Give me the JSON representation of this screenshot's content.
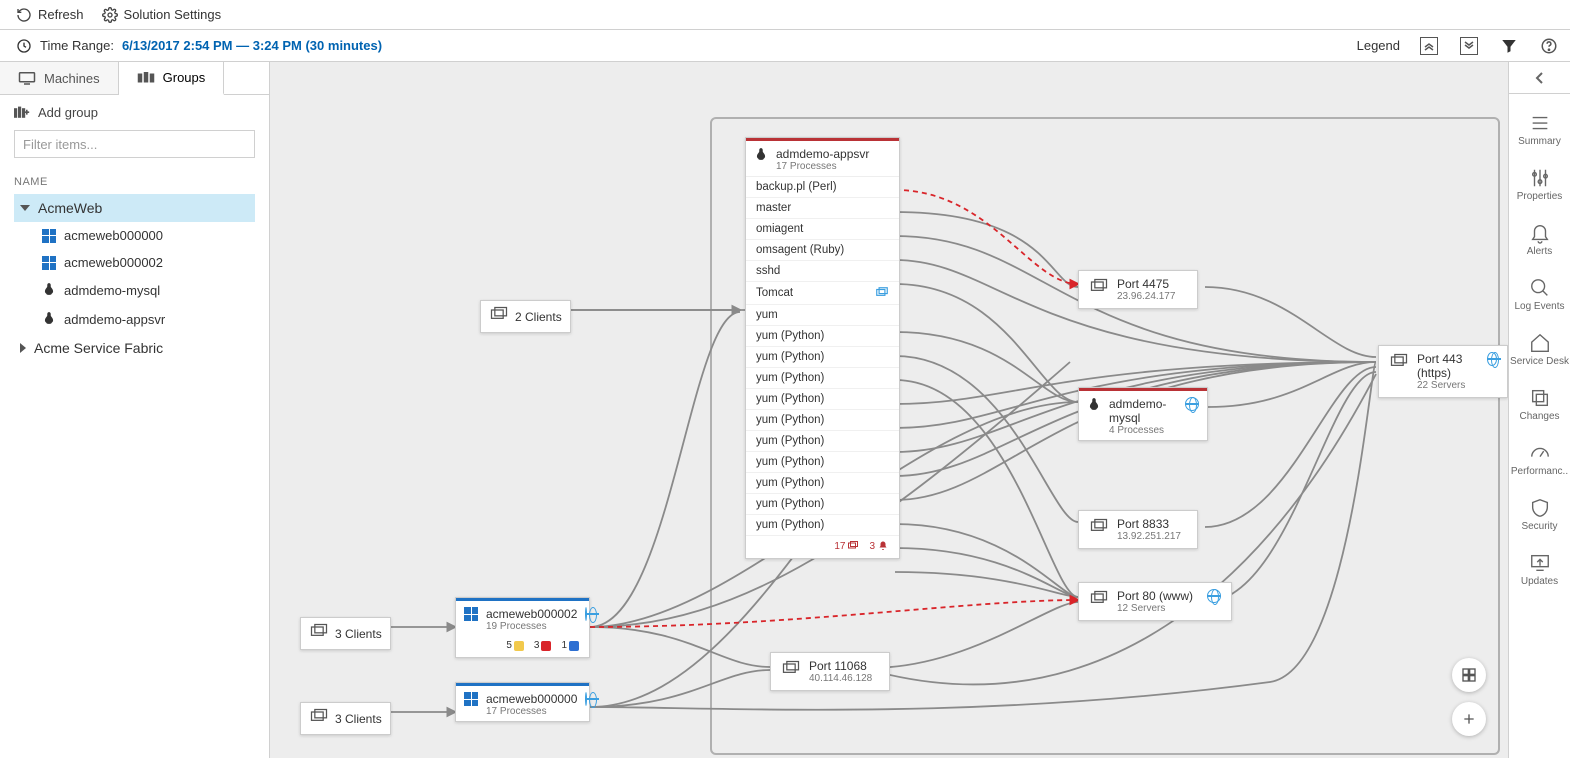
{
  "toolbar": {
    "refresh": "Refresh",
    "settings": "Solution Settings"
  },
  "time_range": {
    "label": "Time Range:",
    "value": "6/13/2017 2:54 PM — 3:24 PM (30 minutes)",
    "legend": "Legend"
  },
  "sidebar": {
    "tabs": {
      "machines": "Machines",
      "groups": "Groups"
    },
    "add_group": "Add group",
    "filter_placeholder": "Filter items...",
    "column_header": "NAME",
    "groups": [
      {
        "name": "AcmeWeb",
        "expanded": true,
        "selected": true,
        "children": [
          {
            "name": "acmeweb000000",
            "os": "windows"
          },
          {
            "name": "acmeweb000002",
            "os": "windows"
          },
          {
            "name": "admdemo-mysql",
            "os": "linux"
          },
          {
            "name": "admdemo-appsvr",
            "os": "linux"
          }
        ]
      },
      {
        "name": "Acme Service Fabric",
        "expanded": false
      }
    ]
  },
  "right_rail": {
    "items": [
      {
        "key": "summary",
        "label": "Summary"
      },
      {
        "key": "properties",
        "label": "Properties"
      },
      {
        "key": "alerts",
        "label": "Alerts"
      },
      {
        "key": "log",
        "label": "Log Events"
      },
      {
        "key": "servicedesk",
        "label": "Service Desk"
      },
      {
        "key": "changes",
        "label": "Changes"
      },
      {
        "key": "performance",
        "label": "Performanc.."
      },
      {
        "key": "security",
        "label": "Security"
      },
      {
        "key": "updates",
        "label": "Updates"
      }
    ]
  },
  "map": {
    "clients2": "2 Clients",
    "clients3a": "3 Clients",
    "clients3b": "3 Clients",
    "machines": {
      "acmeweb000002": {
        "title": "acmeweb000002",
        "sub": "19 Processes",
        "badges": [
          {
            "count": "5",
            "color": "#f2c94c"
          },
          {
            "count": "3",
            "color": "#d9252a"
          },
          {
            "count": "1",
            "color": "#2d6fd2"
          }
        ]
      },
      "acmeweb000000": {
        "title": "acmeweb000000",
        "sub": "17 Processes"
      },
      "appsvr": {
        "title": "admdemo-appsvr",
        "sub": "17 Processes",
        "footer": [
          {
            "count": "17",
            "icon": "stack",
            "color": "#B93236"
          },
          {
            "count": "3",
            "icon": "bell",
            "color": "#B93236"
          }
        ],
        "processes": [
          "backup.pl (Perl)",
          "master",
          "omiagent",
          "omsagent (Ruby)",
          "sshd",
          "Tomcat",
          "yum",
          "yum (Python)",
          "yum (Python)",
          "yum (Python)",
          "yum (Python)",
          "yum (Python)",
          "yum (Python)",
          "yum (Python)",
          "yum (Python)",
          "yum (Python)",
          "yum (Python)"
        ]
      },
      "mysql": {
        "title": "admdemo-mysql",
        "sub": "4 Processes"
      }
    },
    "ports": {
      "p4475": {
        "title": "Port 4475",
        "sub": "23.96.24.177"
      },
      "p443": {
        "title": "Port 443 (https)",
        "sub": "22 Servers"
      },
      "p8833": {
        "title": "Port 8833",
        "sub": "13.92.251.217"
      },
      "p80": {
        "title": "Port 80 (www)",
        "sub": "12 Servers"
      },
      "p11068": {
        "title": "Port 11068",
        "sub": "40.114.46.128"
      }
    }
  }
}
